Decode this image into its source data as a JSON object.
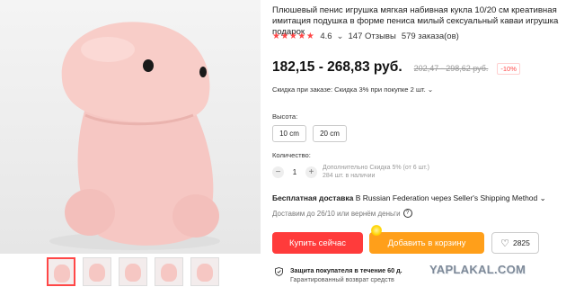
{
  "product": {
    "title": "Плюшевый пенис игрушка мягкая набивная кукла 10/20 см креативная имитация подушка в форме пениса милый сексуальный каваи игрушка подарок",
    "stars": "★★★★★",
    "rating": "4.6",
    "rating_caret": "⌄",
    "reviews": "147 Отзывы",
    "orders": "579 заказа(ов)"
  },
  "price": {
    "current": "182,15 - 268,83 руб.",
    "old": "202,47 - 298,62 руб.",
    "discount": "-10%"
  },
  "order_discount": "Скидка при заказе: Скидка 3% при покупке 2 шт. ⌄",
  "height": {
    "label": "Высота:",
    "options": [
      "10 cm",
      "20 cm"
    ]
  },
  "quantity": {
    "label": "Количество:",
    "minus": "−",
    "value": "1",
    "plus": "+",
    "info_line1": "Дополнительно Скидка 5% (от 6 шт.)",
    "info_line2": "284 шт. в наличии"
  },
  "delivery": {
    "free": "Бесплатная доставка",
    "rest": " В Russian Federation через Seller's Shipping Method ⌄",
    "returns": "Доставим до 26/10 или вернём деньги"
  },
  "buttons": {
    "buy": "Купить сейчас",
    "cart": "Добавить в корзину",
    "wishlist_count": "2825"
  },
  "protection": {
    "line1": "Защита покупателя в течение 60 д.",
    "line2": "Гарантированный возврат средств"
  },
  "watermark": "YAPLAKAL.COM",
  "colors": {
    "accent_red": "#ff3b3b",
    "accent_orange": "#ff9f1a",
    "plush_pink": "#f6c7c3"
  },
  "icons": [
    "star-icon",
    "heart-icon",
    "shield-icon",
    "question-icon"
  ]
}
